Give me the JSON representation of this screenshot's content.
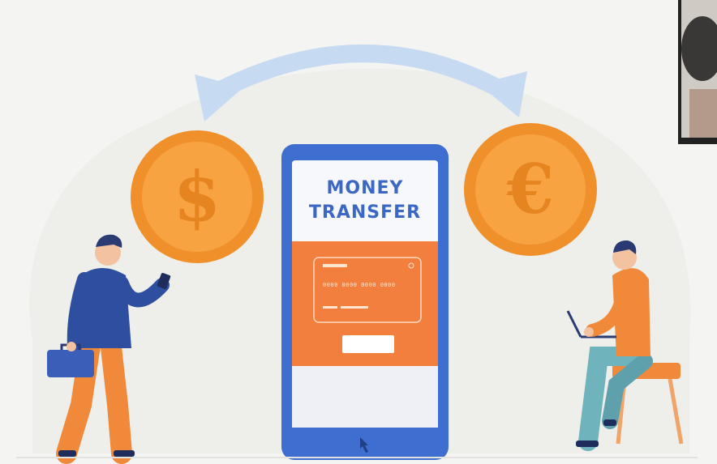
{
  "phone": {
    "title_line1": "MONEY",
    "title_line2": "TRANSFER",
    "card_number": "0000 0000 0000 0000"
  },
  "coins": {
    "left_symbol": "$",
    "right_symbol": "€"
  },
  "colors": {
    "phone_body": "#3e6fd0",
    "phone_screen": "#f7f8fb",
    "card_panel": "#f37f3e",
    "coin_fill": "#f7a341",
    "coin_rim": "#f0902a",
    "arrow": "#c6daf2",
    "shirt_blue": "#2e4fa0",
    "pants_orange": "#f08a3a",
    "shirt_orange": "#f08a3a",
    "pants_teal": "#6fb3bd",
    "hair": "#2a3b74",
    "skin": "#f3c2a1"
  },
  "icons": [
    "dollar-coin-icon",
    "euro-coin-icon",
    "exchange-arrow-icon",
    "briefcase-icon",
    "laptop-icon",
    "smartphone-icon"
  ]
}
